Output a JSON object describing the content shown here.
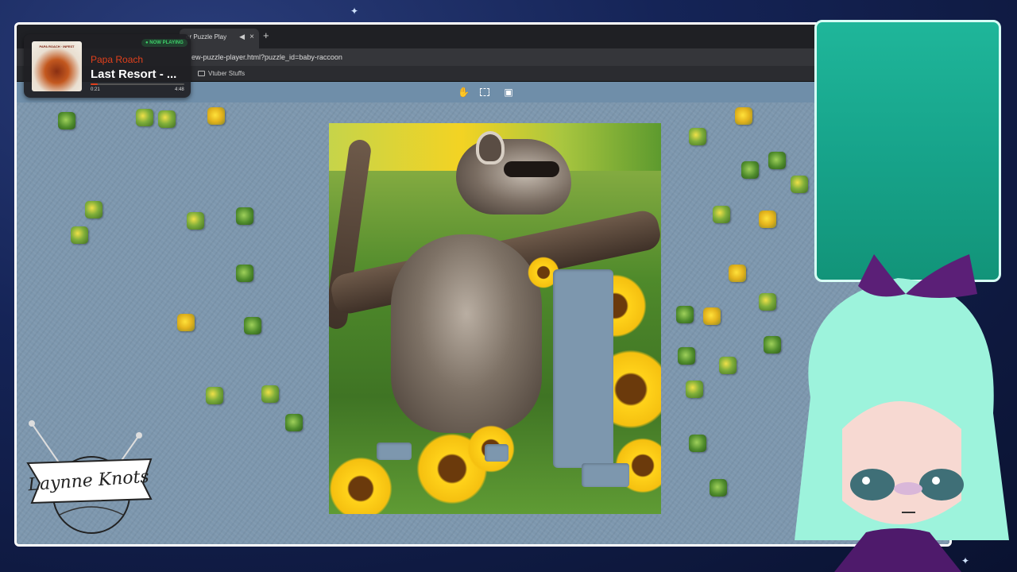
{
  "browser": {
    "tab_title": "er Puzzle Play",
    "url": "ew-puzzle-player.html?puzzle_id=baby-raccoon",
    "bookmark": "Vtuber Stuffs",
    "new_tab": "+",
    "tab_close": "×",
    "tab_audio": "◀))"
  },
  "toolbar": {
    "pan_tool_icon": "hand-icon",
    "select_tool_icon": "selection-icon",
    "image_tool_icon": "image-icon"
  },
  "now_playing": {
    "badge": "● NOW PLAYING",
    "artist": "Papa Roach",
    "song": "Last Resort - ...",
    "current_time": "0:21",
    "total_time": "4:48",
    "progress": 0.073,
    "art_caption": "PAPA ROACH · INFEST"
  },
  "logo": {
    "text": "Laynne Knots"
  },
  "colors": {
    "accent": "#e0401c",
    "table": "#7d97ae",
    "panel": "#1fb69a",
    "toolbar": "#6f8ea9"
  }
}
